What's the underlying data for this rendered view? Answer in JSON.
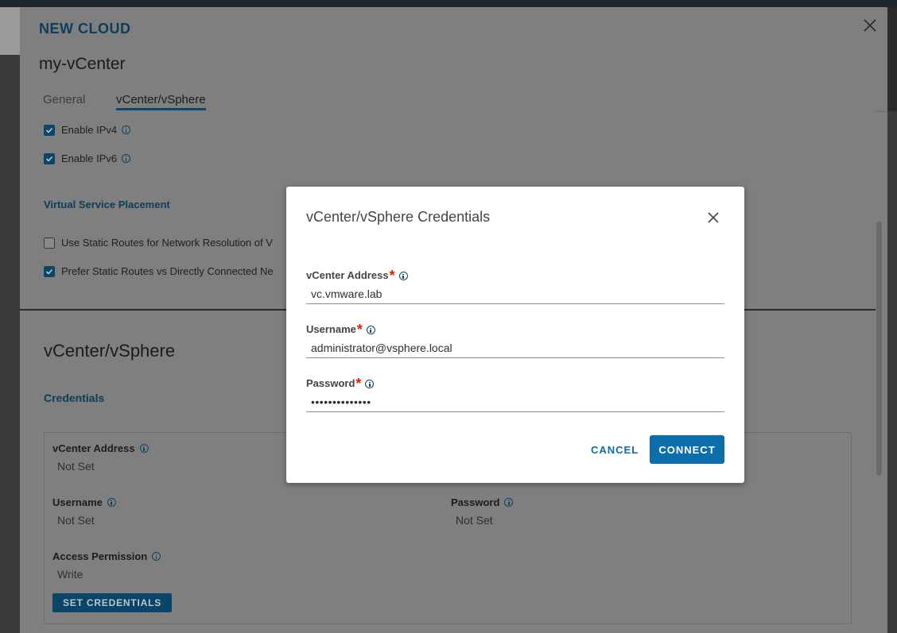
{
  "header": {
    "title": "NEW CLOUD",
    "cloud_name": "my-vCenter",
    "tabs": [
      {
        "label": "General"
      },
      {
        "label": "vCenter/vSphere"
      }
    ]
  },
  "network": {
    "enable_ipv4": {
      "label": "Enable IPv4",
      "checked": true
    },
    "enable_ipv6": {
      "label": "Enable IPv6",
      "checked": true
    },
    "placement_title": "Virtual Service Placement",
    "static_routes": {
      "label": "Use Static Routes for Network Resolution of V",
      "checked": false
    },
    "prefer_static": {
      "label": "Prefer Static Routes vs Directly Connected Ne",
      "checked": true
    }
  },
  "vcenter_section": {
    "heading": "vCenter/vSphere",
    "credentials_link": "Credentials",
    "fields": {
      "address_label": "vCenter Address",
      "address_value": "Not Set",
      "username_label": "Username",
      "username_value": "Not Set",
      "password_label": "Password",
      "password_value": "Not Set",
      "access_label": "Access Permission",
      "access_value": "Write"
    },
    "set_credentials_label": "SET CREDENTIALS"
  },
  "modal": {
    "title": "vCenter/vSphere Credentials",
    "address_label": "vCenter Address",
    "address_value": "vc.vmware.lab",
    "username_label": "Username",
    "username_value": "administrator@vsphere.local",
    "password_label": "Password",
    "password_value": "••••••••••••••",
    "required_mark": "*",
    "cancel_label": "CANCEL",
    "connect_label": "CONNECT"
  },
  "colors": {
    "primary": "#0c6eaa",
    "required": "#e12200",
    "header_title": "#0c3e59"
  }
}
